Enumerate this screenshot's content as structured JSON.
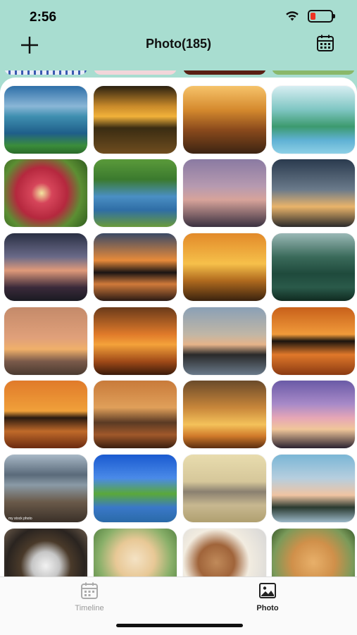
{
  "status_bar": {
    "time": "2:56"
  },
  "header": {
    "title": "Photo(185)"
  },
  "grid": {
    "watermark": "my stock photo",
    "tiles": [
      {
        "name": "lake-village",
        "bg": "linear-gradient(180deg,#2e6fa8 0%,#8ab6d6 30%,#3f8fb0 45%,#1f5e8a 70%,#3b8d3b 88%,#2a6a2a 100%)"
      },
      {
        "name": "sunset-tree-lake",
        "bg": "linear-gradient(180deg,#2a2010 0%,#c98a2a 30%,#f2b23a 45%,#3a2c12 62%,#6f4d1f 100%)"
      },
      {
        "name": "forest-sunrays",
        "bg": "linear-gradient(180deg,#f6c36a 0%,#d58a2e 35%,#8a4a1c 65%,#3c2412 100%)"
      },
      {
        "name": "karst-mountains",
        "bg": "linear-gradient(180deg,#d7eef2 0%,#7fc6c3 35%,#3c9a6e 60%,#5fb1d4 80%,#8ed0e6 100%)"
      },
      {
        "name": "dahlia-flower",
        "bg": "radial-gradient(circle at 45% 50%,#f2e6a0 0%,#d6455a 18%,#b5283e 45%,#5c8f33 70%,#2f5c1e 100%)"
      },
      {
        "name": "river-bridge",
        "bg": "linear-gradient(180deg,#5a9a3a 0%,#3b7a2e 30%,#4a8fc4 55%,#2f6ea6 75%,#6a9a3a 100%)"
      },
      {
        "name": "grass-silhouette-dusk",
        "bg": "linear-gradient(180deg,#8a7aa2 0%,#b69ab0 40%,#d7a39a 60%,#3a3040 100%)"
      },
      {
        "name": "grass-silhouette-sunrise",
        "bg": "linear-gradient(180deg,#2a3a4e 0%,#6a7a8a 45%,#e9b46a 70%,#2a2a2a 100%)"
      },
      {
        "name": "lake-reflection-dusk",
        "bg": "linear-gradient(180deg,#2a3044 0%,#6a6a88 35%,#e09a7a 55%,#3a2a3a 80%,#1a1a22 100%)"
      },
      {
        "name": "acacia-sunset",
        "bg": "linear-gradient(180deg,#3a4a66 0%,#e78a3a 40%,#1a1414 58%,#d07a3a 75%,#2a1a14 100%)"
      },
      {
        "name": "hands-sun",
        "bg": "linear-gradient(180deg,#e28a2a 0%,#f6c04a 45%,#b06a1e 70%,#3a220e 100%)"
      },
      {
        "name": "waterfall-valley",
        "bg": "linear-gradient(180deg,#9ab8b6 0%,#3a6a5a 35%,#1f4a3c 60%,#2a5a4a 80%,#102a20 100%)"
      },
      {
        "name": "reeds-sunset",
        "bg": "linear-gradient(180deg,#c48a6a 0%,#e0a07a 45%,#f0b06a 62%,#7a5a4a 80%,#4a3a30 100%)"
      },
      {
        "name": "trees-orange-lake",
        "bg": "linear-gradient(180deg,#6a3a1a 0%,#e07a2a 40%,#f4a23a 55%,#a04a18 80%,#3a1a0a 100%)"
      },
      {
        "name": "tree-island-dusk",
        "bg": "linear-gradient(180deg,#8aa0b6 0%,#c0b6a6 40%,#e6b48a 55%,#2a2a2a 70%,#6a7a8a 100%)"
      },
      {
        "name": "tree-orange-reflection",
        "bg": "linear-gradient(180deg,#c8601a 0%,#f09a3a 40%,#1a140e 50%,#e0782a 70%,#8a3a12 100%)"
      },
      {
        "name": "pier-trees-sunset",
        "bg": "linear-gradient(180deg,#e07a2a 0%,#f0a03a 45%,#2a1a10 55%,#c06a2a 75%,#6a2a10 100%)"
      },
      {
        "name": "bare-trees-sunset",
        "bg": "linear-gradient(180deg,#c87a3a 0%,#e0a05a 40%,#5a3a24 62%,#a0582a 80%,#3a1e10 100%)"
      },
      {
        "name": "grass-sun-orange",
        "bg": "linear-gradient(180deg,#6a4a2a 0%,#c8863a 40%,#f4c25a 65%,#d07a2a 82%,#5a2e10 100%)"
      },
      {
        "name": "palm-purple-sky",
        "bg": "linear-gradient(180deg,#6a5aa6 0%,#a88ac8 35%,#e6a6b6 55%,#f0c69a 72%,#2a2230 100%)"
      },
      {
        "name": "mountain-lake-rocks",
        "bg": "linear-gradient(180deg,#a8b8c6 0%,#5a6a7a 30%,#8a9aa6 45%,#6a5a4a 70%,#3a3028 100%)"
      },
      {
        "name": "house-lake-blue-sky",
        "bg": "linear-gradient(180deg,#1a5ad0 0%,#4a8ae8 35%,#5aa83a 58%,#3a78c8 78%,#2a6aa8 100%)"
      },
      {
        "name": "old-suv",
        "bg": "linear-gradient(180deg,#e8dcae 0%,#d6c79a 40%,#8a8070 55%,#c8b890 75%,#b0a070 100%)"
      },
      {
        "name": "lake-sunset-calm",
        "bg": "linear-gradient(180deg,#7ab6d6 0%,#b6cede 35%,#f0c4a2 60%,#2a3a30 78%,#9ab6c6 100%)"
      },
      {
        "name": "husky-dog",
        "bg": "radial-gradient(circle at 50% 55%,#f2f2f2 0%,#c6c6c6 25%,#4a3a2a 45%,#2a2420 70%,#6a5a4a 100%)"
      },
      {
        "name": "lab-puppy",
        "bg": "radial-gradient(circle at 50% 45%,#f4e2c4 0%,#e8c896 35%,#8ab06a 65%,#4a7a3a 100%)"
      },
      {
        "name": "beagle-dog",
        "bg": "radial-gradient(circle at 40% 50%,#c08a5a 0%,#a0643a 30%,#f2ece0 55%,#d6d6d6 100%)"
      },
      {
        "name": "golden-retriever",
        "bg": "radial-gradient(circle at 50% 50%,#e8b06a 0%,#d0904a 40%,#7a9a5a 75%,#3a5a2a 100%)"
      }
    ]
  },
  "tabbar": {
    "timeline_label": "Timeline",
    "photo_label": "Photo"
  },
  "colors": {
    "header_bg": "#a8ddd0",
    "grid_bg": "#ffffff",
    "active_tab": "#222222",
    "inactive_tab": "#999999"
  }
}
